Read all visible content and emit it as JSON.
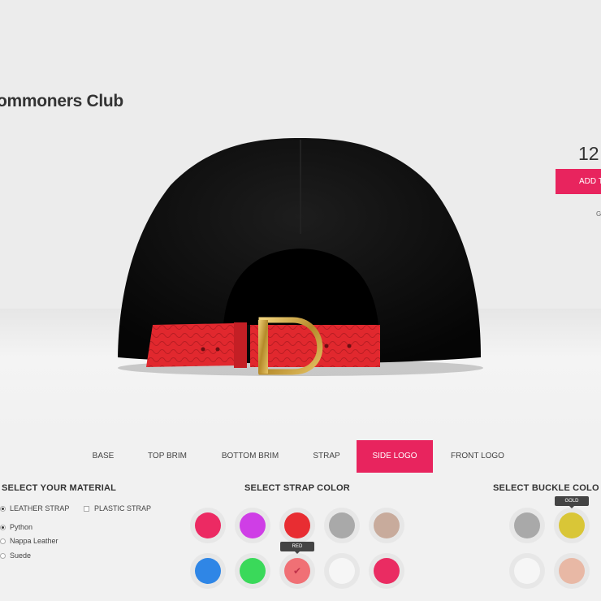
{
  "product": {
    "title": "ommoners Club",
    "price": "12",
    "add_button": "ADD T",
    "gift_text": "G"
  },
  "tabs": [
    {
      "label": "BASE",
      "active": false
    },
    {
      "label": "TOP BRIM",
      "active": false
    },
    {
      "label": "BOTTOM BRIM",
      "active": false
    },
    {
      "label": "STRAP",
      "active": false
    },
    {
      "label": "SIDE LOGO",
      "active": true
    },
    {
      "label": "FRONT LOGO",
      "active": false
    }
  ],
  "material": {
    "title": "SELECT YOUR MATERIAL",
    "type_options": [
      {
        "label": "LEATHER STRAP",
        "selected": true
      },
      {
        "label": "PLASTIC STRAP",
        "selected": false
      }
    ],
    "leather_options": [
      {
        "label": "Python",
        "selected": true
      },
      {
        "label": "Nappa Leather",
        "selected": false
      },
      {
        "label": "Suede",
        "selected": false
      }
    ]
  },
  "strap_color": {
    "title": "SELECT STRAP COLOR",
    "swatches": [
      {
        "color": "#ec2a63"
      },
      {
        "color": "#cf3ee6"
      },
      {
        "color": "#e82d32"
      },
      {
        "color": "#a9a9a9"
      },
      {
        "color": "#c8ab9c"
      },
      {
        "color": "#2f86e6"
      },
      {
        "color": "#3ad95a"
      },
      {
        "color": "#f07075",
        "selected": true,
        "tooltip": "RED"
      },
      {
        "color": "#f6f6f6"
      },
      {
        "color": "#ea2c62"
      }
    ]
  },
  "buckle_color": {
    "title": "SELECT BUCKLE COLO",
    "swatches": [
      {
        "color": "#a9a9a9"
      },
      {
        "color": "#d9c637",
        "tooltip": "GOLD"
      },
      {
        "color": "#f6f6f6"
      },
      {
        "color": "#e8b8a5"
      }
    ]
  },
  "colors": {
    "accent": "#e8245e",
    "cap": "#0c0c0c",
    "strap": "#e02a30",
    "buckle": "#c9a544"
  }
}
